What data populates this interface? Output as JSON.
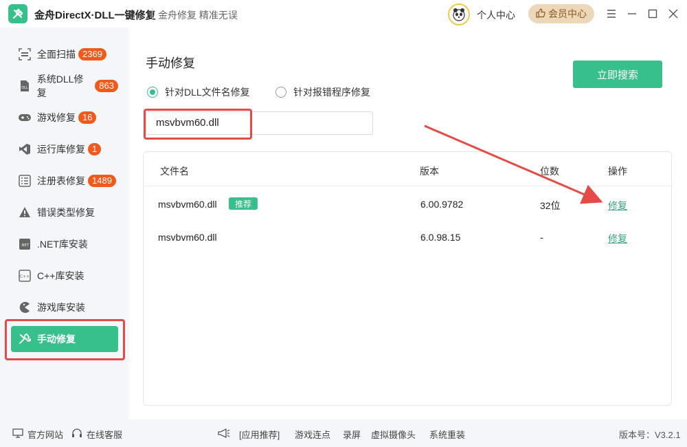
{
  "titlebar": {
    "app_title": "金舟DirectX·DLL一键修复",
    "slogan": "金舟修复 精准无误",
    "user_center": "个人中心",
    "vip_label": "会员中心"
  },
  "sidebar": {
    "items": [
      {
        "label": "全面扫描",
        "badge": "2369",
        "icon": "scan-icon"
      },
      {
        "label": "系统DLL修复",
        "badge": "863",
        "icon": "dll-icon"
      },
      {
        "label": "游戏修复",
        "badge": "16",
        "icon": "gamepad-icon"
      },
      {
        "label": "运行库修复",
        "badge": "1",
        "icon": "visual-studio-icon"
      },
      {
        "label": "注册表修复",
        "badge": "1489",
        "icon": "registry-list-icon"
      },
      {
        "label": "错误类型修复",
        "badge": "",
        "icon": "warning-icon"
      },
      {
        "label": ".NET库安装",
        "badge": "",
        "icon": "dotnet-icon"
      },
      {
        "label": "C++库安装",
        "badge": "",
        "icon": "cpp-icon"
      },
      {
        "label": "游戏库安装",
        "badge": "",
        "icon": "pacman-icon"
      },
      {
        "label": "手动修复",
        "badge": "",
        "icon": "wrench-icon",
        "active": true
      }
    ]
  },
  "main": {
    "title": "手动修复",
    "search_button": "立即搜索",
    "radio_options": [
      {
        "label": "针对DLL文件名修复",
        "checked": true
      },
      {
        "label": "针对报错程序修复",
        "checked": false
      }
    ],
    "input_value": "msvbvm60.dll",
    "table": {
      "headers": [
        "文件名",
        "版本",
        "位数",
        "操作"
      ],
      "rows": [
        {
          "file": "msvbvm60.dll",
          "tag": "推荐",
          "version": "6.00.9782",
          "bits": "32位",
          "action": "修复"
        },
        {
          "file": "msvbvm60.dll",
          "tag": "",
          "version": "6.0.98.15",
          "bits": "-",
          "action": "修复"
        }
      ]
    }
  },
  "footer": {
    "website": "官方网站",
    "service": "在线客服",
    "links": [
      "[应用推荐]",
      "游戏连点",
      "录屏",
      "虚拟摄像头",
      "系统重装"
    ],
    "version": "版本号：V3.2.1"
  },
  "colors": {
    "accent": "#37c08c",
    "badge": "#f15a1b",
    "highlight": "#e64a47"
  }
}
